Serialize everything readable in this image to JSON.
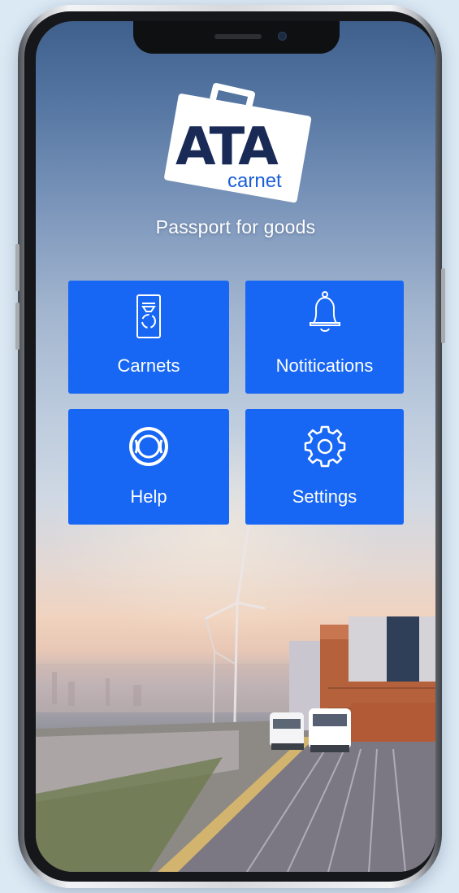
{
  "app": {
    "logo": {
      "title_text": "ATA",
      "sub_text": "carnet"
    },
    "tagline": "Passport for goods"
  },
  "menu": {
    "tiles": [
      {
        "label": "Carnets",
        "icon": "carnet-document-icon"
      },
      {
        "label": "Notitications",
        "icon": "bell-icon"
      },
      {
        "label": "Help",
        "icon": "lifebuoy-icon"
      },
      {
        "label": "Settings",
        "icon": "gear-icon"
      }
    ]
  },
  "colors": {
    "tile_blue": "#1766f4",
    "logo_navy": "#1a2a57",
    "logo_blue": "#1b5fd6"
  }
}
